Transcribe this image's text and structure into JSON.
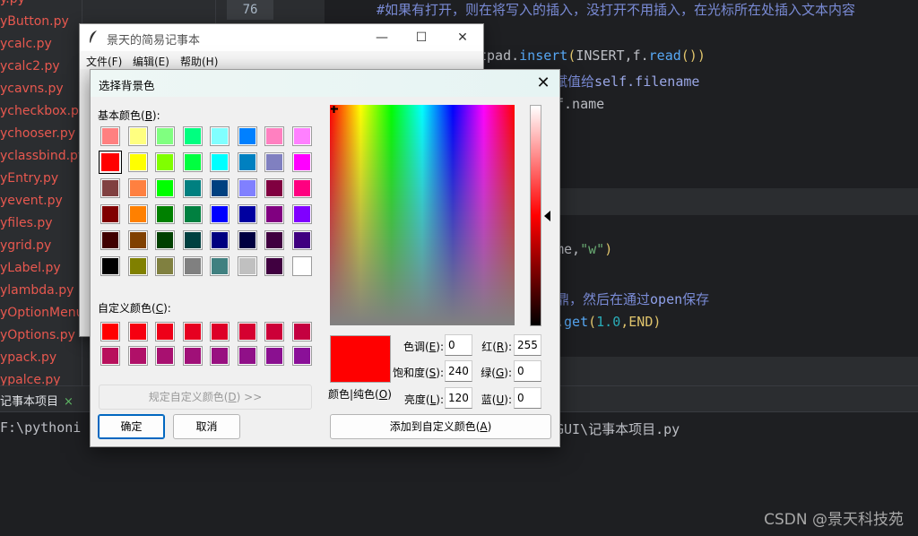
{
  "ide": {
    "file_tree": [
      "yButton.py",
      "ycalc.py",
      "ycalc2.py",
      "ycavns.py",
      "ycheckbox.py",
      "ychooser.py",
      "yclassbind.py",
      "yEntry.py",
      "yevent.py",
      "yfiles.py",
      "ygrid.py",
      "yLabel.py",
      "ylambda.py",
      "yOptionMenu",
      "yOptions.py",
      "ypack.py",
      "ypalce.py"
    ],
    "partial_top_file": "y.py",
    "line_number": "76",
    "code": {
      "l1_comment": "#如果有打开，则在将写入的插入，没打开不用插入，在光标所在处插入文本内容",
      "l2_pre": "tpad.",
      "l2_func": "insert",
      "l2_paren": "(",
      "l2_mid": "INSERT,f.",
      "l2_func2": "read",
      "l2_end": "())",
      "l3_comment": "赋值给",
      "l3_self": "self.filename",
      "l4": "f.name",
      "l5_pre": "me,",
      "l5_str": "\"w\"",
      "l5_end": ")",
      "l6_comment": "鼎，然后在通过",
      "l6_kw": "open",
      "l6_tail": "保存",
      "l7_pre": ".",
      "l7_func": "get",
      "l7_paren": "(",
      "l7_num": "1.0",
      "l7_end": ",END)"
    },
    "run_tab": "记事本项目",
    "run_tab_close": "×",
    "console_left": "F:\\pythoni",
    "console_right": "GUI\\记事本项目.py",
    "watermark": "CSDN @景天科技苑"
  },
  "notepad": {
    "title": "景天的简易记事本",
    "icon": "feather-icon",
    "menus": [
      "文件(F)",
      "编辑(E)",
      "帮助(H)"
    ],
    "min": "—",
    "max": "☐",
    "close": "✕"
  },
  "dialog": {
    "title": "选择背景色",
    "close": "✕",
    "basic_colors_label": "基本颜色(",
    "basic_colors_key": "B",
    "basic_colors_end": "):",
    "basic_colors": [
      "#ff8080",
      "#ffff80",
      "#80ff80",
      "#00ff80",
      "#80ffff",
      "#0080ff",
      "#ff80c0",
      "#ff80ff",
      "#ff0000",
      "#ffff00",
      "#80ff00",
      "#00ff40",
      "#00ffff",
      "#0080c0",
      "#8080c0",
      "#ff00ff",
      "#804040",
      "#ff8040",
      "#00ff00",
      "#008080",
      "#004080",
      "#8080ff",
      "#800040",
      "#ff0080",
      "#800000",
      "#ff8000",
      "#008000",
      "#008040",
      "#0000ff",
      "#0000a0",
      "#800080",
      "#8000ff",
      "#400000",
      "#804000",
      "#004000",
      "#004040",
      "#000080",
      "#000040",
      "#400040",
      "#400080",
      "#000000",
      "#808000",
      "#808040",
      "#808080",
      "#408080",
      "#c0c0c0",
      "#400040",
      "#ffffff"
    ],
    "selected_index": 8,
    "custom_colors_label": "自定义颜色(",
    "custom_colors_key": "C",
    "custom_colors_end": "):",
    "custom_colors": [
      "#ff0000",
      "#f60010",
      "#ee0018",
      "#e60020",
      "#dd0028",
      "#d50030",
      "#cc0038",
      "#c40040",
      "#b8105c",
      "#b01068",
      "#a81070",
      "#a01078",
      "#981080",
      "#901088",
      "#8a1090",
      "#8a1098"
    ],
    "define_custom_btn": "规定自定义颜色(",
    "define_custom_key": "D",
    "define_custom_end": ") >>",
    "ok_btn": "确定",
    "cancel_btn": "取消",
    "preview_label_a": "颜色|纯色(",
    "preview_label_key": "O",
    "preview_label_end": ")",
    "hue_label": "色调(",
    "hue_key": "E",
    "hue_value": "0",
    "sat_label": "饱和度(",
    "sat_key": "S",
    "sat_value": "240",
    "lum_label": "亮度(",
    "lum_key": "L",
    "lum_value": "120",
    "red_label": "红(",
    "red_key": "R",
    "red_value": "255",
    "green_label": "绿(",
    "green_key": "G",
    "green_value": "0",
    "blue_label": "蓝(",
    "blue_key": "U",
    "blue_value": "0",
    "label_end": "):",
    "add_custom_btn": "添加到自定义颜色(",
    "add_custom_key": "A",
    "add_custom_end": ")"
  }
}
